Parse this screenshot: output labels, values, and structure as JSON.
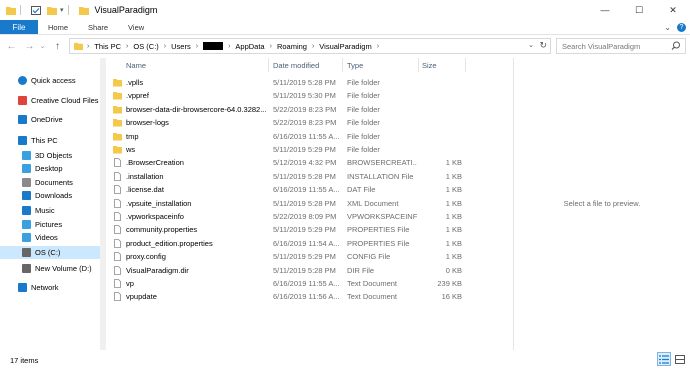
{
  "titlebar": {
    "title": "VisualParadigm",
    "minimize": "—",
    "maximize": "☐",
    "close": "✕"
  },
  "ribbon": {
    "tabs": [
      "File",
      "Home",
      "Share",
      "View"
    ],
    "expand": "⌄",
    "help": "?"
  },
  "address": {
    "crumbs": [
      "This PC",
      "OS (C:)",
      "Users",
      "",
      "AppData",
      "Roaming",
      "VisualParadigm"
    ],
    "search_placeholder": "Search VisualParadigm"
  },
  "nav": {
    "items": [
      {
        "label": "Quick access",
        "icon": "star-icon",
        "color": "#1979ca",
        "selected": false
      },
      {
        "label": "Creative Cloud Files",
        "icon": "cloud-icon",
        "color": "#e0433b",
        "selected": false
      },
      {
        "label": "OneDrive",
        "icon": "onedrive-icon",
        "color": "#1979ca",
        "selected": false
      },
      {
        "label": "This PC",
        "icon": "pc-icon",
        "color": "#1979ca",
        "selected": false
      },
      {
        "label": "3D Objects",
        "icon": "cube-icon",
        "color": "#3aa0e0",
        "selected": false
      },
      {
        "label": "Desktop",
        "icon": "desktop-icon",
        "color": "#3aa0e0",
        "selected": false
      },
      {
        "label": "Documents",
        "icon": "document-icon",
        "color": "#8a8a8a",
        "selected": false
      },
      {
        "label": "Downloads",
        "icon": "download-icon",
        "color": "#1979ca",
        "selected": false
      },
      {
        "label": "Music",
        "icon": "music-icon",
        "color": "#1979ca",
        "selected": false
      },
      {
        "label": "Pictures",
        "icon": "pictures-icon",
        "color": "#3aa0e0",
        "selected": false
      },
      {
        "label": "Videos",
        "icon": "video-icon",
        "color": "#3aa0e0",
        "selected": false
      },
      {
        "label": "OS (C:)",
        "icon": "drive-icon",
        "color": "#666666",
        "selected": true
      },
      {
        "label": "New Volume (D:)",
        "icon": "drive-icon",
        "color": "#666666",
        "selected": false
      },
      {
        "label": "Network",
        "icon": "network-icon",
        "color": "#1979ca",
        "selected": false
      }
    ]
  },
  "columns": {
    "name": "Name",
    "date": "Date modified",
    "type": "Type",
    "size": "Size"
  },
  "files": [
    {
      "name": ".vplls",
      "date": "5/11/2019 5:28 PM",
      "type": "File folder",
      "size": "",
      "kind": "folder"
    },
    {
      "name": ".vppref",
      "date": "5/11/2019 5:30 PM",
      "type": "File folder",
      "size": "",
      "kind": "folder"
    },
    {
      "name": "browser-data-dir-browsercore-64.0.3282...",
      "date": "5/22/2019 8:23 PM",
      "type": "File folder",
      "size": "",
      "kind": "folder"
    },
    {
      "name": "browser-logs",
      "date": "5/22/2019 8:23 PM",
      "type": "File folder",
      "size": "",
      "kind": "folder"
    },
    {
      "name": "tmp",
      "date": "6/16/2019 11:55 A...",
      "type": "File folder",
      "size": "",
      "kind": "folder"
    },
    {
      "name": "ws",
      "date": "5/11/2019 5:29 PM",
      "type": "File folder",
      "size": "",
      "kind": "folder"
    },
    {
      "name": ".BrowserCreation",
      "date": "5/12/2019 4:32 PM",
      "type": "BROWSERCREATI...",
      "size": "1 KB",
      "kind": "file"
    },
    {
      "name": ".installation",
      "date": "5/11/2019 5:28 PM",
      "type": "INSTALLATION File",
      "size": "1 KB",
      "kind": "file"
    },
    {
      "name": ".license.dat",
      "date": "6/16/2019 11:55 A...",
      "type": "DAT File",
      "size": "1 KB",
      "kind": "file"
    },
    {
      "name": ".vpsuite_installation",
      "date": "5/11/2019 5:28 PM",
      "type": "XML Document",
      "size": "1 KB",
      "kind": "file"
    },
    {
      "name": ".vpworkspaceinfo",
      "date": "5/22/2019 8:09 PM",
      "type": "VPWORKSPACEINF...",
      "size": "1 KB",
      "kind": "file"
    },
    {
      "name": "community.properties",
      "date": "5/11/2019 5:29 PM",
      "type": "PROPERTIES File",
      "size": "1 KB",
      "kind": "file"
    },
    {
      "name": "product_edition.properties",
      "date": "6/16/2019 11:54 A...",
      "type": "PROPERTIES File",
      "size": "1 KB",
      "kind": "file"
    },
    {
      "name": "proxy.config",
      "date": "5/11/2019 5:29 PM",
      "type": "CONFIG File",
      "size": "1 KB",
      "kind": "file"
    },
    {
      "name": "VisualParadigm.dir",
      "date": "5/11/2019 5:28 PM",
      "type": "DIR File",
      "size": "0 KB",
      "kind": "file"
    },
    {
      "name": "vp",
      "date": "6/16/2019 11:55 A...",
      "type": "Text Document",
      "size": "239 KB",
      "kind": "file"
    },
    {
      "name": "vpupdate",
      "date": "6/16/2019 11:56 A...",
      "type": "Text Document",
      "size": "16 KB",
      "kind": "file"
    }
  ],
  "preview": {
    "message": "Select a file to preview."
  },
  "status": {
    "count": "17 items"
  },
  "colors": {
    "accent": "#1979ca",
    "selected": "#cce8ff",
    "folder": "#f4c84a"
  }
}
